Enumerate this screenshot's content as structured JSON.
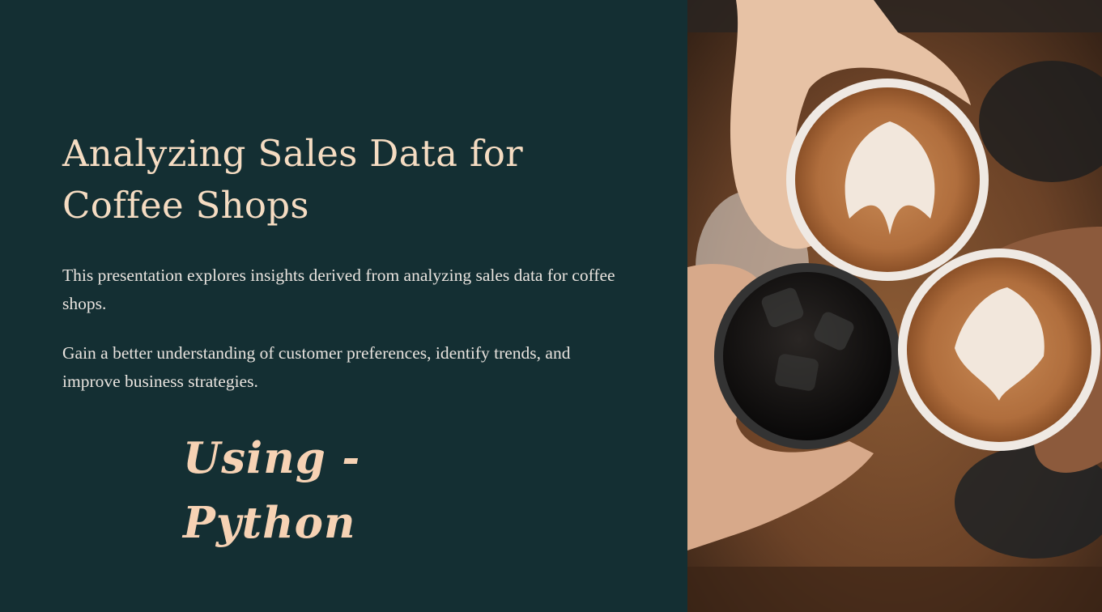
{
  "slide": {
    "title": "Analyzing Sales Data for Coffee Shops",
    "paragraphs": [
      "This presentation explores insights derived from analyzing sales data for coffee shops.",
      "Gain a better understanding of customer preferences, identify trends, and improve business strategies."
    ],
    "subtitle": "Using - Python"
  },
  "colors": {
    "background": "#142f33",
    "title": "#f5dcc2",
    "body_text": "#e9e4df",
    "subtitle": "#f6d2b4"
  }
}
